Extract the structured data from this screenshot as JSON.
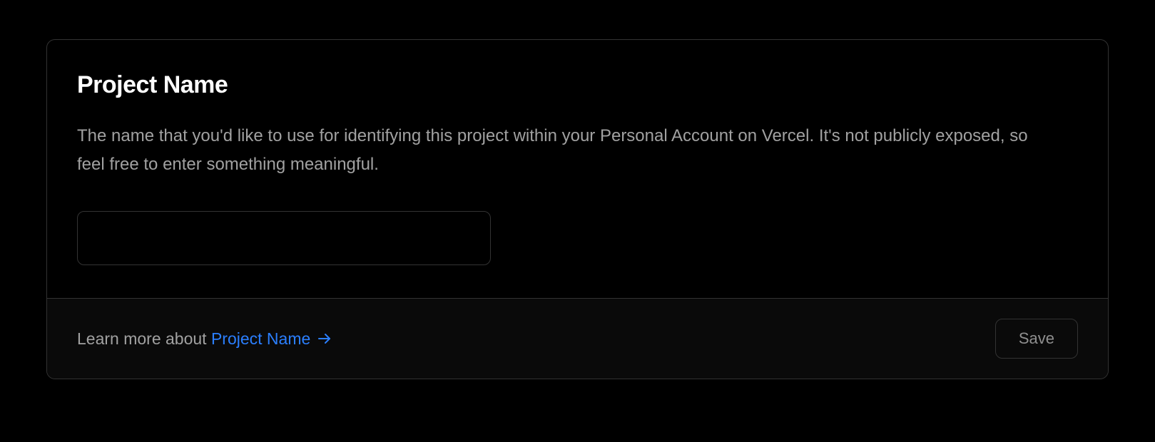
{
  "card": {
    "title": "Project Name",
    "description": "The name that you'd like to use for identifying this project within your Personal Account on Vercel. It's not publicly exposed, so feel free to enter something meaningful.",
    "input_value": "",
    "footer": {
      "learn_more_prefix": "Learn more about ",
      "learn_more_link_text": "Project Name",
      "save_label": "Save"
    }
  },
  "colors": {
    "link": "#2b7fff",
    "border": "#333333",
    "text_muted": "#a1a1a1"
  }
}
